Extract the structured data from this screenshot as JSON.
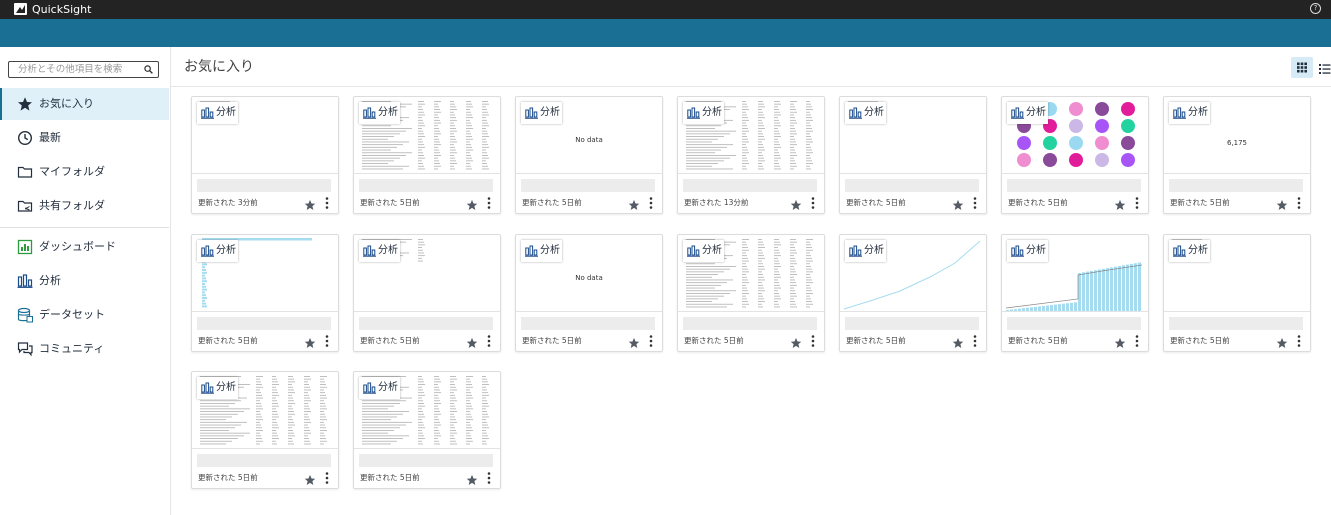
{
  "app": {
    "name": "QuickSight",
    "help_icon": "help-circle-icon"
  },
  "search": {
    "placeholder": "分析とその他項目を検索",
    "icon": "search-icon"
  },
  "sidebar": {
    "items": [
      {
        "label": "お気に入り",
        "icon": "star-icon",
        "active": true
      },
      {
        "label": "最新",
        "icon": "clock-icon",
        "active": false
      },
      {
        "label": "マイフォルダ",
        "icon": "folder-icon",
        "active": false
      },
      {
        "label": "共有フォルダ",
        "icon": "shared-folder-icon",
        "active": false
      },
      {
        "label": "ダッシュボード",
        "icon": "dashboard-icon",
        "active": false
      },
      {
        "label": "分析",
        "icon": "analysis-icon",
        "active": false
      },
      {
        "label": "データセット",
        "icon": "dataset-icon",
        "active": false
      },
      {
        "label": "コミュニティ",
        "icon": "community-icon",
        "active": false
      }
    ]
  },
  "main": {
    "title": "お気に入り",
    "view_toggle": {
      "grid_icon": "grid-view-icon",
      "list_icon": "list-view-icon",
      "selected": "grid"
    }
  },
  "colors": {
    "topbar": "#232323",
    "accent_bar": "#1a6f95",
    "selected_nav": "#dff0f8",
    "chart_bar": "#a6dcef"
  },
  "cards": [
    {
      "type_label": "分析",
      "updated": "更新された 3分前",
      "thumb": "blank",
      "favorite": true
    },
    {
      "type_label": "分析",
      "updated": "更新された 5日前",
      "thumb": "table",
      "favorite": true
    },
    {
      "type_label": "分析",
      "updated": "更新された 5日前",
      "thumb": "nodata",
      "thumb_text": "No data",
      "favorite": true
    },
    {
      "type_label": "分析",
      "updated": "更新された 13分前",
      "thumb": "table",
      "favorite": true
    },
    {
      "type_label": "分析",
      "updated": "更新された 5日前",
      "thumb": "blank",
      "favorite": true
    },
    {
      "type_label": "分析",
      "updated": "更新された 5日前",
      "thumb": "pies",
      "favorite": true
    },
    {
      "type_label": "分析",
      "updated": "更新された 5日前",
      "thumb": "kpi",
      "thumb_text": "6,175",
      "favorite": true
    },
    {
      "type_label": "分析",
      "updated": "更新された 5日前",
      "thumb": "hbars",
      "favorite": true
    },
    {
      "type_label": "分析",
      "updated": "更新された 5日前",
      "thumb": "minitable",
      "favorite": true
    },
    {
      "type_label": "分析",
      "updated": "更新された 5日前",
      "thumb": "nodata",
      "thumb_text": "No data",
      "favorite": true
    },
    {
      "type_label": "分析",
      "updated": "更新された 5日前",
      "thumb": "table",
      "favorite": true
    },
    {
      "type_label": "分析",
      "updated": "更新された 5日前",
      "thumb": "line",
      "favorite": true
    },
    {
      "type_label": "分析",
      "updated": "更新された 5日前",
      "thumb": "barsline",
      "favorite": true
    },
    {
      "type_label": "分析",
      "updated": "更新された 5日前",
      "thumb": "blank",
      "favorite": true
    },
    {
      "type_label": "分析",
      "updated": "更新された 5日前",
      "thumb": "table",
      "favorite": true
    },
    {
      "type_label": "分析",
      "updated": "更新された 5日前",
      "thumb": "table",
      "favorite": true
    }
  ]
}
